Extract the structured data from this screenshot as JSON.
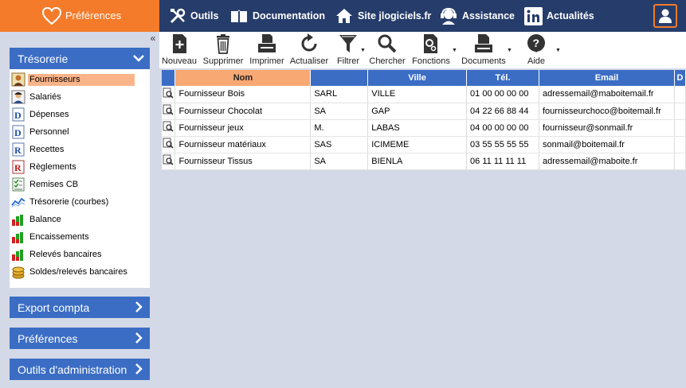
{
  "topbar": {
    "preferences": "Préférences",
    "nav": [
      {
        "label": "Outils",
        "icon": "tools-icon"
      },
      {
        "label": "Documentation",
        "icon": "book-icon"
      },
      {
        "label": "Site jlogiciels.fr",
        "icon": "home-icon"
      },
      {
        "label": "Assistance",
        "icon": "headset-icon"
      },
      {
        "label": "Actualités",
        "icon": "linkedin-icon"
      }
    ],
    "user_icon": "user-icon",
    "colors": {
      "bar": "#263d6b",
      "accent": "#f47b2a"
    }
  },
  "sidebar": {
    "collapse": "«",
    "tresorerie": {
      "title": "Trésorerie",
      "items": [
        {
          "label": "Fournisseurs",
          "icon": "supplier-icon"
        },
        {
          "label": "Salariés",
          "icon": "employee-icon"
        },
        {
          "label": "Dépenses",
          "icon": "expense-icon"
        },
        {
          "label": "Personnel",
          "icon": "staff-icon"
        },
        {
          "label": "Recettes",
          "icon": "revenue-icon"
        },
        {
          "label": "Règlements",
          "icon": "payment-icon"
        },
        {
          "label": "Remises CB",
          "icon": "card-remittance-icon"
        },
        {
          "label": "Trésorerie (courbes)",
          "icon": "line-chart-icon"
        },
        {
          "label": "Balance",
          "icon": "bar-chart-icon"
        },
        {
          "label": "Encaissements",
          "icon": "bar-chart-icon"
        },
        {
          "label": "Relevés bancaires",
          "icon": "bar-chart-icon"
        },
        {
          "label": "Soldes/relevés bancaires",
          "icon": "coins-icon"
        }
      ]
    },
    "sections": [
      "Export compta",
      "Préférences",
      "Outils d'administration"
    ],
    "section_color": "#3b6dc4"
  },
  "toolbar": {
    "buttons": [
      {
        "label": "Nouveau",
        "icon": "new-document-icon"
      },
      {
        "label": "Supprimer",
        "icon": "trash-icon"
      },
      {
        "label": "Imprimer",
        "icon": "printer-icon"
      },
      {
        "label": "Actualiser",
        "icon": "refresh-icon"
      },
      {
        "label": "Filtrer",
        "icon": "filter-icon"
      },
      {
        "label": "Chercher",
        "icon": "search-icon"
      },
      {
        "label": "Fonctions",
        "icon": "functions-icon"
      },
      {
        "label": "Documents",
        "icon": "documents-icon"
      },
      {
        "label": "Aide",
        "icon": "help-icon"
      }
    ]
  },
  "table": {
    "columns": [
      "",
      "Nom",
      "",
      "Ville",
      "Tél.",
      "Email",
      "D"
    ],
    "sorted_column": "Nom",
    "rows": [
      [
        "Fournisseur Bois",
        "SARL",
        "VILLE",
        "01 00 00 00 00",
        "adressemail@maboitemail.fr"
      ],
      [
        "Fournisseur Chocolat",
        "SA",
        "GAP",
        "04 22 66 88 44",
        "fournisseurchoco@boitemail.fr"
      ],
      [
        "Fournisseur jeux",
        "M.",
        "LABAS",
        "04 00 00 00 00",
        "fournisseur@sonmail.fr"
      ],
      [
        "Fournisseur matériaux",
        "SAS",
        "ICIMEME",
        "03 55 55 55 55",
        "sonmail@boitemail.fr"
      ],
      [
        "Fournisseur Tissus",
        "SA",
        "BIENLA",
        "06 11 11 11 11",
        "adressemail@maboite.fr"
      ]
    ]
  }
}
